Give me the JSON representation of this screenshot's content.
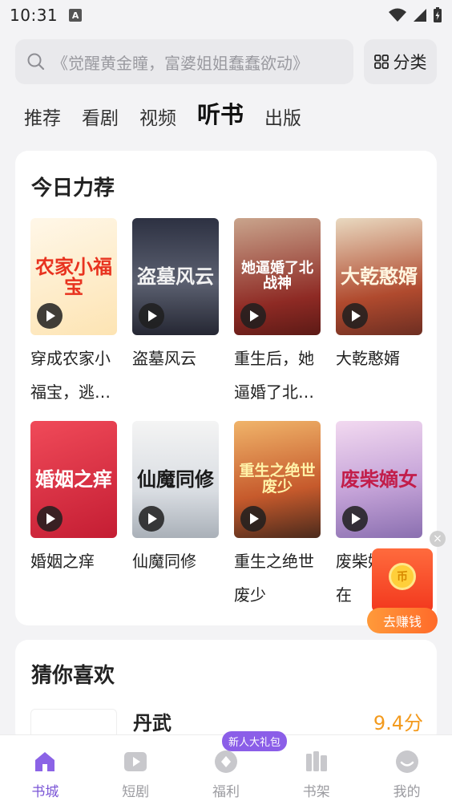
{
  "status_bar": {
    "time": "10:31",
    "notification_letter": "A"
  },
  "search": {
    "placeholder": "《觉醒黄金瞳，富婆姐姐蠢蠢欲动》",
    "category_label": "分类"
  },
  "tabs": [
    {
      "label": "推荐",
      "active": false
    },
    {
      "label": "看剧",
      "active": false
    },
    {
      "label": "视频",
      "active": false
    },
    {
      "label": "听书",
      "active": true
    },
    {
      "label": "出版",
      "active": false
    }
  ],
  "recommend": {
    "title": "今日力荐",
    "books": [
      {
        "title": "穿成农家小福宝，逃荒路上开挂了",
        "cover_text": "农家小福宝"
      },
      {
        "title": "盗墓风云",
        "cover_text": "盗墓风云"
      },
      {
        "title": "重生后，她逼婚了北战神",
        "cover_text": "她逼婚了北战神"
      },
      {
        "title": "大乾憨婿",
        "cover_text": "大乾憨婿"
      },
      {
        "title": "婚姻之痒",
        "cover_text": "婚姻之痒"
      },
      {
        "title": "仙魔同修",
        "cover_text": "仙魔同修"
      },
      {
        "title": "重生之绝世废少",
        "cover_text": "重生之绝世废少"
      },
      {
        "title": "废柴嫡女又在",
        "cover_text": "废柴嫡女"
      }
    ]
  },
  "guess": {
    "title": "猜你喜欢",
    "first_book": {
      "title": "丹武",
      "score": "9.4分"
    }
  },
  "reward": {
    "label": "去赚钱",
    "close": "×",
    "coin": "币"
  },
  "bottom_nav": [
    {
      "label": "书城",
      "icon": "home-icon",
      "active": true
    },
    {
      "label": "短剧",
      "icon": "play-icon",
      "active": false
    },
    {
      "label": "福利",
      "icon": "gift-icon",
      "active": false,
      "badge": "新人大礼包"
    },
    {
      "label": "书架",
      "icon": "bookshelf-icon",
      "active": false
    },
    {
      "label": "我的",
      "icon": "profile-icon",
      "active": false
    }
  ],
  "colors": {
    "accent": "#7a55d6",
    "score": "#f39a1d",
    "reward": "#f2371d"
  }
}
